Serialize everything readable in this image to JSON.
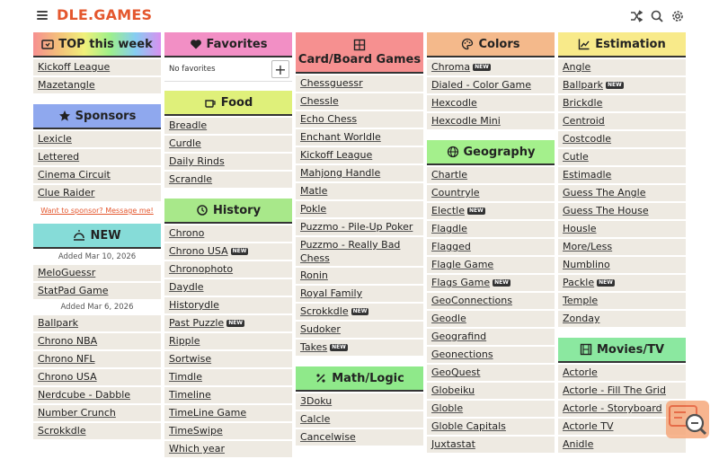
{
  "header": {
    "logo": "DLE.GAMES",
    "icons": [
      "menu-icon",
      "shuffle-icon",
      "search-icon",
      "gear-icon"
    ]
  },
  "columns": {
    "col1": {
      "top_week": {
        "title": "TOP this week",
        "items": [
          "Kickoff League",
          "Mazetangle"
        ]
      },
      "sponsors": {
        "title": "Sponsors",
        "items": [
          "Lexicle",
          "Lettered",
          "Cinema Circuit",
          "Clue Raider"
        ],
        "sponsor_link": "Want to sponsor? Message me!"
      },
      "new": {
        "title": "NEW",
        "date1": "Added Mar 10, 2026",
        "group1": [
          "MeloGuessr",
          "StatPad Game"
        ],
        "date2": "Added Mar 6, 2026",
        "group2": [
          "Ballpark",
          "Chrono NBA",
          "Chrono NFL",
          "Chrono USA",
          "Nerdcube - Dabble",
          "Number Crunch",
          "Scrokkdle"
        ]
      }
    },
    "col2": {
      "favorites": {
        "title": "Favorites",
        "empty_text": "No favorites",
        "add_label": "+"
      },
      "food": {
        "title": "Food",
        "items": [
          "Breadle",
          "Curdle",
          "Daily Rinds",
          "Scrandle"
        ]
      },
      "history": {
        "title": "History",
        "items": [
          "Chrono",
          "Chrono USA",
          "Chronophoto",
          "Daydle",
          "Historydle",
          "Past Puzzle",
          "Ripple",
          "Sortwise",
          "Timdle",
          "Timeline",
          "TimeLine Game",
          "TimeSwipe",
          "Which year"
        ]
      }
    },
    "col3": {
      "card_board": {
        "title": "Card/Board Games",
        "items": [
          "Chessguessr",
          "Chessle",
          "Echo Chess",
          "Enchant Worldle",
          "Kickoff League",
          "Mahjong Handle",
          "Matle",
          "Pokle",
          "Puzzmo - Pile-Up Poker",
          "Puzzmo - Really Bad Chess",
          "Ronin",
          "Royal Family",
          "Scrokkdle",
          "Sudoker",
          "Takes"
        ]
      },
      "math_logic": {
        "title": "Math/Logic",
        "items": [
          "3Doku",
          "Calcle",
          "Cancelwise"
        ]
      }
    },
    "col4": {
      "colors": {
        "title": "Colors",
        "items": [
          "Chroma",
          "Dialed - Color Game",
          "Hexcodle",
          "Hexcodle Mini"
        ]
      },
      "geography": {
        "title": "Geography",
        "items": [
          "Chartle",
          "Countryle",
          "Electle",
          "Flagdle",
          "Flagged",
          "Flagle Game",
          "Flags Game",
          "GeoConnections",
          "Geodle",
          "Geografind",
          "Geonections",
          "GeoQuest",
          "Globeiku",
          "Globle",
          "Globle Capitals",
          "Juxtastat"
        ]
      }
    },
    "col5": {
      "estimation": {
        "title": "Estimation",
        "items": [
          "Angle",
          "Ballpark",
          "Brickdle",
          "Centroid",
          "Costcodle",
          "Cutle",
          "Estimadle",
          "Guess The Angle",
          "Guess The House",
          "Housle",
          "More/Less",
          "Numblino",
          "Packle",
          "Temple",
          "Zonday"
        ]
      },
      "movies_tv": {
        "title": "Movies/TV",
        "items": [
          "Actorle",
          "Actorle - Fill The Grid",
          "Actorle - Storyboard",
          "Actorle TV",
          "Anidle"
        ]
      }
    }
  },
  "badge_text": "NEW",
  "colors": {
    "logo": "#e4572e",
    "favorites": "#f28fc5",
    "food": "#dff07a",
    "history": "#a8e88a",
    "card_board": "#f69090",
    "math_logic": "#8fe98a",
    "colors_hdr": "#f4b98b",
    "geography": "#a4f08c",
    "estimation": "#f8ea8a",
    "movies_tv": "#8be8a0",
    "sponsors": "#8fa8ee",
    "new": "#86dcd8"
  }
}
